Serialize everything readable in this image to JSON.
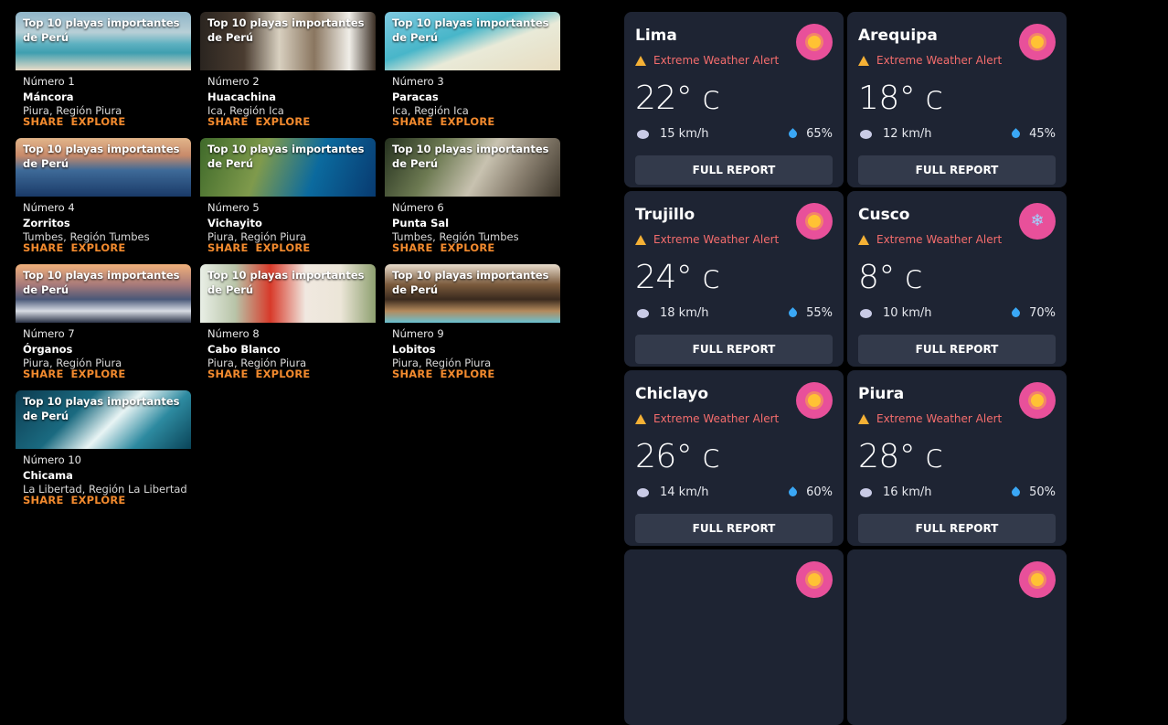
{
  "beaches": [
    {
      "title": "Top 10 playas importantes de Perú",
      "number": "Número 1",
      "name": "Máncora",
      "region": "Piura, Región Piura",
      "share": "SHARE",
      "explore": "EXPLORE"
    },
    {
      "title": "Top 10 playas importantes de Perú",
      "number": "Número 2",
      "name": "Huacachina",
      "region": "Ica, Región Ica",
      "share": "SHARE",
      "explore": "EXPLORE"
    },
    {
      "title": "Top 10 playas importantes de Perú",
      "number": "Número 3",
      "name": "Paracas",
      "region": "Ica, Región Ica",
      "share": "SHARE",
      "explore": "EXPLORE"
    },
    {
      "title": "Top 10 playas importantes de Perú",
      "number": "Número 4",
      "name": "Zorritos",
      "region": "Tumbes, Región Tumbes",
      "share": "SHARE",
      "explore": "EXPLORE"
    },
    {
      "title": "Top 10 playas importantes de Perú",
      "number": "Número 5",
      "name": "Vichayito",
      "region": "Piura, Región Piura",
      "share": "SHARE",
      "explore": "EXPLORE"
    },
    {
      "title": "Top 10 playas importantes de Perú",
      "number": "Número 6",
      "name": "Punta Sal",
      "region": "Tumbes, Región Tumbes",
      "share": "SHARE",
      "explore": "EXPLORE"
    },
    {
      "title": "Top 10 playas importantes de Perú",
      "number": "Número 7",
      "name": "Órganos",
      "region": "Piura, Región Piura",
      "share": "SHARE",
      "explore": "EXPLORE"
    },
    {
      "title": "Top 10 playas importantes de Perú",
      "number": "Número 8",
      "name": "Cabo Blanco",
      "region": "Piura, Región Piura",
      "share": "SHARE",
      "explore": "EXPLORE"
    },
    {
      "title": "Top 10 playas importantes de Perú",
      "number": "Número 9",
      "name": "Lobitos",
      "region": "Piura, Región Piura",
      "share": "SHARE",
      "explore": "EXPLORE"
    },
    {
      "title": "Top 10 playas importantes de Perú",
      "number": "Número 10",
      "name": "Chicama",
      "region": "La Libertad, Región La Libertad",
      "share": "SHARE",
      "explore": "EXPLORE"
    }
  ],
  "weather": [
    {
      "city": "Lima",
      "icon": "sun-icon",
      "alert": "Extreme Weather Alert",
      "temp": "22° c",
      "wind": "15 km/h",
      "humidity": "65%",
      "button": "FULL REPORT"
    },
    {
      "city": "Arequipa",
      "icon": "sun-icon",
      "alert": "Extreme Weather Alert",
      "temp": "18° c",
      "wind": "12 km/h",
      "humidity": "45%",
      "button": "FULL REPORT"
    },
    {
      "city": "Trujillo",
      "icon": "sun-icon",
      "alert": "Extreme Weather Alert",
      "temp": "24° c",
      "wind": "18 km/h",
      "humidity": "55%",
      "button": "FULL REPORT"
    },
    {
      "city": "Cusco",
      "icon": "snowflake-icon",
      "alert": "Extreme Weather Alert",
      "temp": "8° c",
      "wind": "10 km/h",
      "humidity": "70%",
      "button": "FULL REPORT"
    },
    {
      "city": "Chiclayo",
      "icon": "sun-icon",
      "alert": "Extreme Weather Alert",
      "temp": "26° c",
      "wind": "14 km/h",
      "humidity": "60%",
      "button": "FULL REPORT"
    },
    {
      "city": "Piura",
      "icon": "sun-icon",
      "alert": "Extreme Weather Alert",
      "temp": "28° c",
      "wind": "16 km/h",
      "humidity": "50%",
      "button": "FULL REPORT"
    },
    {
      "city": "",
      "icon": "sun-icon",
      "alert": "",
      "temp": "",
      "wind": "",
      "humidity": "",
      "button": ""
    },
    {
      "city": "",
      "icon": "sun-icon",
      "alert": "",
      "temp": "",
      "wind": "",
      "humidity": "",
      "button": ""
    }
  ],
  "colors": {
    "accent_orange": "#f28a2e",
    "card_bg": "#1e2433",
    "button_bg": "#333a4b",
    "icon_badge": "#e8509a",
    "alert_text": "#f56d6d",
    "warning_icon": "#f5b135",
    "sun": "#ffc234",
    "humidity_drop": "#3aa7f5"
  }
}
